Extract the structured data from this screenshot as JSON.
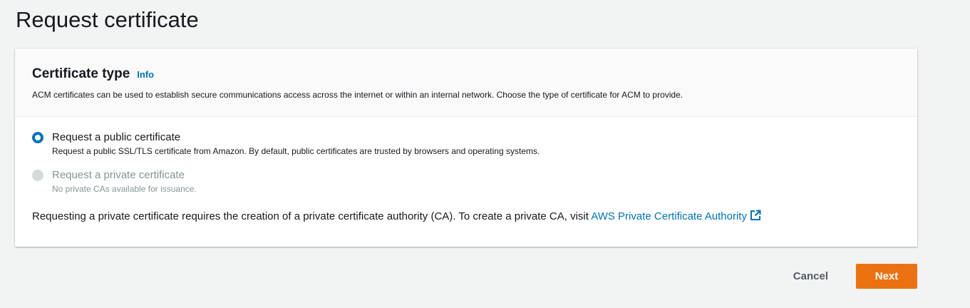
{
  "page": {
    "title": "Request certificate"
  },
  "certificate_type": {
    "title": "Certificate type",
    "info_link": "Info",
    "description": "ACM certificates can be used to establish secure communications access across the internet or within an internal network. Choose the type of certificate for ACM to provide.",
    "options": [
      {
        "label": "Request a public certificate",
        "description": "Request a public SSL/TLS certificate from Amazon. By default, public certificates are trusted by browsers and operating systems.",
        "selected": true,
        "disabled": false
      },
      {
        "label": "Request a private certificate",
        "description": "No private CAs available for issuance.",
        "selected": false,
        "disabled": true
      }
    ],
    "private_note": "Requesting a private certificate requires the creation of a private certificate authority (CA). To create a private CA, visit ",
    "private_link": "AWS Private Certificate Authority",
    "private_link_icon": "external-link-icon"
  },
  "actions": {
    "cancel_label": "Cancel",
    "next_label": "Next"
  },
  "colors": {
    "accent": "#0073bb",
    "primary_button": "#ec7211",
    "background": "#f2f3f3"
  }
}
